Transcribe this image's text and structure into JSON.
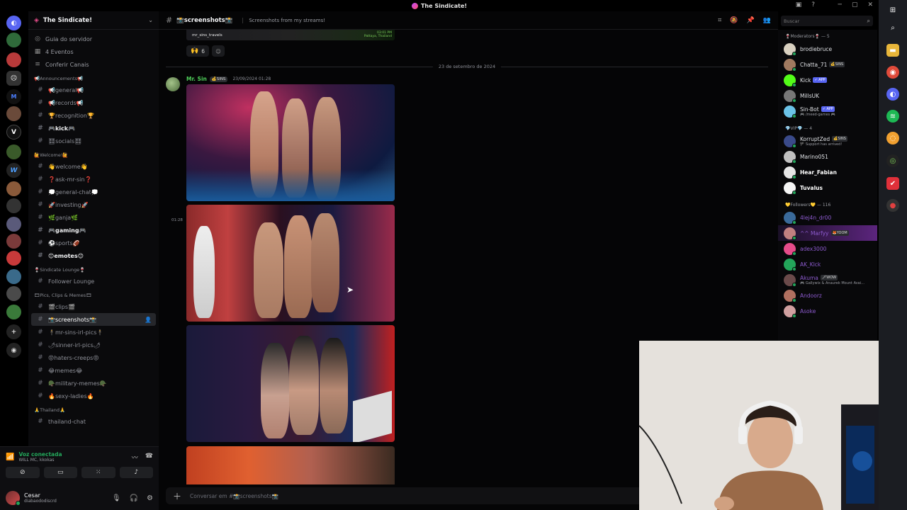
{
  "window": {
    "title": "The Sindicate!"
  },
  "guild": {
    "name": "The Sindicate!"
  },
  "nav": [
    {
      "label": "Guia do servidor",
      "icon": "compass-icon",
      "glyph": "◎"
    },
    {
      "label": "4 Eventos",
      "icon": "calendar-icon",
      "glyph": "▦"
    },
    {
      "label": "Conferir Canais",
      "icon": "list-icon",
      "glyph": "≡"
    }
  ],
  "categories": {
    "announcements": "📢Announcements📢",
    "welcome": "🙋Welcome!🙋",
    "lounge": "🍷Sindicate Lounge🍷",
    "pics": "🎞Pics, Clips & Memes🎞",
    "thailand": "🙏Thailand🙏"
  },
  "channels_announcements": [
    {
      "label": "📢general📢",
      "bold": false
    },
    {
      "label": "📢records📢",
      "bold": false
    },
    {
      "label": "🏆recognition🏆",
      "bold": false
    },
    {
      "label": "🎮kick🎮",
      "bold": true
    },
    {
      "label": "🎛socials🎛",
      "bold": false
    }
  ],
  "channels_welcome": [
    {
      "label": "👋welcome👋",
      "bold": false
    },
    {
      "label": "❓ask-mr-sin❓",
      "bold": false
    },
    {
      "label": "💭general-chat💭",
      "bold": false
    },
    {
      "label": "🚀investing🚀",
      "bold": false
    },
    {
      "label": "🌿ganja🌿",
      "bold": false
    },
    {
      "label": "🎮gaming🎮",
      "bold": true
    },
    {
      "label": "⚽sports🏈",
      "bold": false
    },
    {
      "label": "😊emotes😊",
      "bold": true
    }
  ],
  "channels_lounge": [
    {
      "label": "Follower Lounge",
      "bold": false
    }
  ],
  "channels_pics": [
    {
      "label": "🎬clips🎬",
      "bold": false
    },
    {
      "label": "📸screenshots📸",
      "bold": false,
      "active": true
    },
    {
      "label": "🕴mr-sins-irl-pics🕴",
      "bold": false
    },
    {
      "label": "🌶sinner-irl-pics🌶",
      "bold": false
    },
    {
      "label": "😡haters-creeps😡",
      "bold": false
    },
    {
      "label": "😂memes😂",
      "bold": false
    },
    {
      "label": "🪖military-memes🪖",
      "bold": false
    },
    {
      "label": "🔥sexy-ladies🔥",
      "bold": false
    }
  ],
  "channels_thailand": [
    {
      "label": "thailand-chat",
      "bold": false
    }
  ],
  "voice": {
    "status": "Voz conectada",
    "sub": "WILL MC, kkokas"
  },
  "user": {
    "name": "Cesar",
    "tag": "diabaododiscrd"
  },
  "channel": {
    "name": "📸screenshots📸",
    "topic": "Screenshots from my streams!",
    "composer_placeholder": "Conversar em #📸screenshots📸"
  },
  "search": {
    "placeholder": "Buscar"
  },
  "prev_message": {
    "image_tag": "mr_sins_travels",
    "image_time": "03:01 PM",
    "image_location": "Pattaya, Thailand",
    "reaction_count": "6"
  },
  "date_divider": "23 de setembro de 2024",
  "message": {
    "author": "Mr. Sin",
    "badge": "💰SINS",
    "timestamp": "23/09/2024 01:28",
    "side_time": "01:28"
  },
  "member_categories": {
    "moderators": "🍷Moderators🍷 — 5",
    "vip": "💎VIP💎 — 4",
    "followers": "💛Followers💛 — 116"
  },
  "moderators": [
    {
      "name": "brodiebruce",
      "color": "#d8d0c0"
    },
    {
      "name": "Chatta_71",
      "badge": "💰SINS",
      "color": "#a07a60"
    },
    {
      "name": "Kick",
      "app": "✓ APP",
      "color": "#53fc18"
    },
    {
      "name": "MillsUK",
      "color": "#777"
    },
    {
      "name": "Sin-Bot",
      "app": "✓ APP",
      "sub": "🎮 /meed-games 🎮",
      "color": "#6bc3e8"
    }
  ],
  "vip": [
    {
      "name": "KorruptZed",
      "badge": "💰SINS",
      "sub": "🏴 Support has arrived!",
      "color": "#3a4a8a"
    },
    {
      "name": "Marino051",
      "color": "#c0c0c0"
    },
    {
      "name": "Hear_Fabian",
      "color": "#e6e6e6"
    },
    {
      "name": "Tuvalus",
      "color": "#f5f5f5"
    }
  ],
  "followers": [
    {
      "name": "4lej4n_dr00",
      "color": "#3a6a9a"
    },
    {
      "name": "^^ Marfyy",
      "badge": "🦊YOOM",
      "color": "#c08080"
    },
    {
      "name": "adex3000",
      "color": "#e64c8a"
    },
    {
      "name": "AK_Klck",
      "color": "#23a55a"
    },
    {
      "name": "Akuma",
      "badge": "🗡WOW",
      "sub": "🎮 Gallywix & Anaurek Mount Avai...",
      "color": "#6a4a4a"
    },
    {
      "name": "Andoorz",
      "color": "#b07060"
    },
    {
      "name": "Asoke",
      "color": "#d0a0a0"
    }
  ]
}
